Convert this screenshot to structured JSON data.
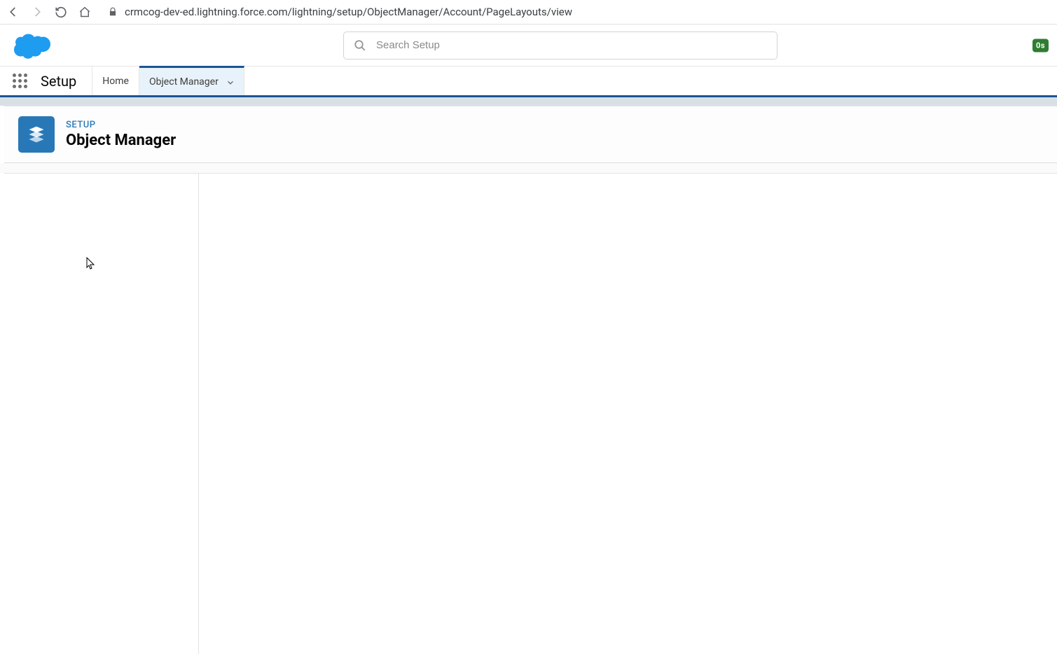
{
  "browser": {
    "url": "crmcog-dev-ed.lightning.force.com/lightning/setup/ObjectManager/Account/PageLayouts/view"
  },
  "header": {
    "search_placeholder": "Search Setup",
    "badge": "0s"
  },
  "nav": {
    "context": "Setup",
    "home_label": "Home",
    "object_manager_label": "Object Manager"
  },
  "page": {
    "eyebrow": "SETUP",
    "title": "Object Manager"
  }
}
